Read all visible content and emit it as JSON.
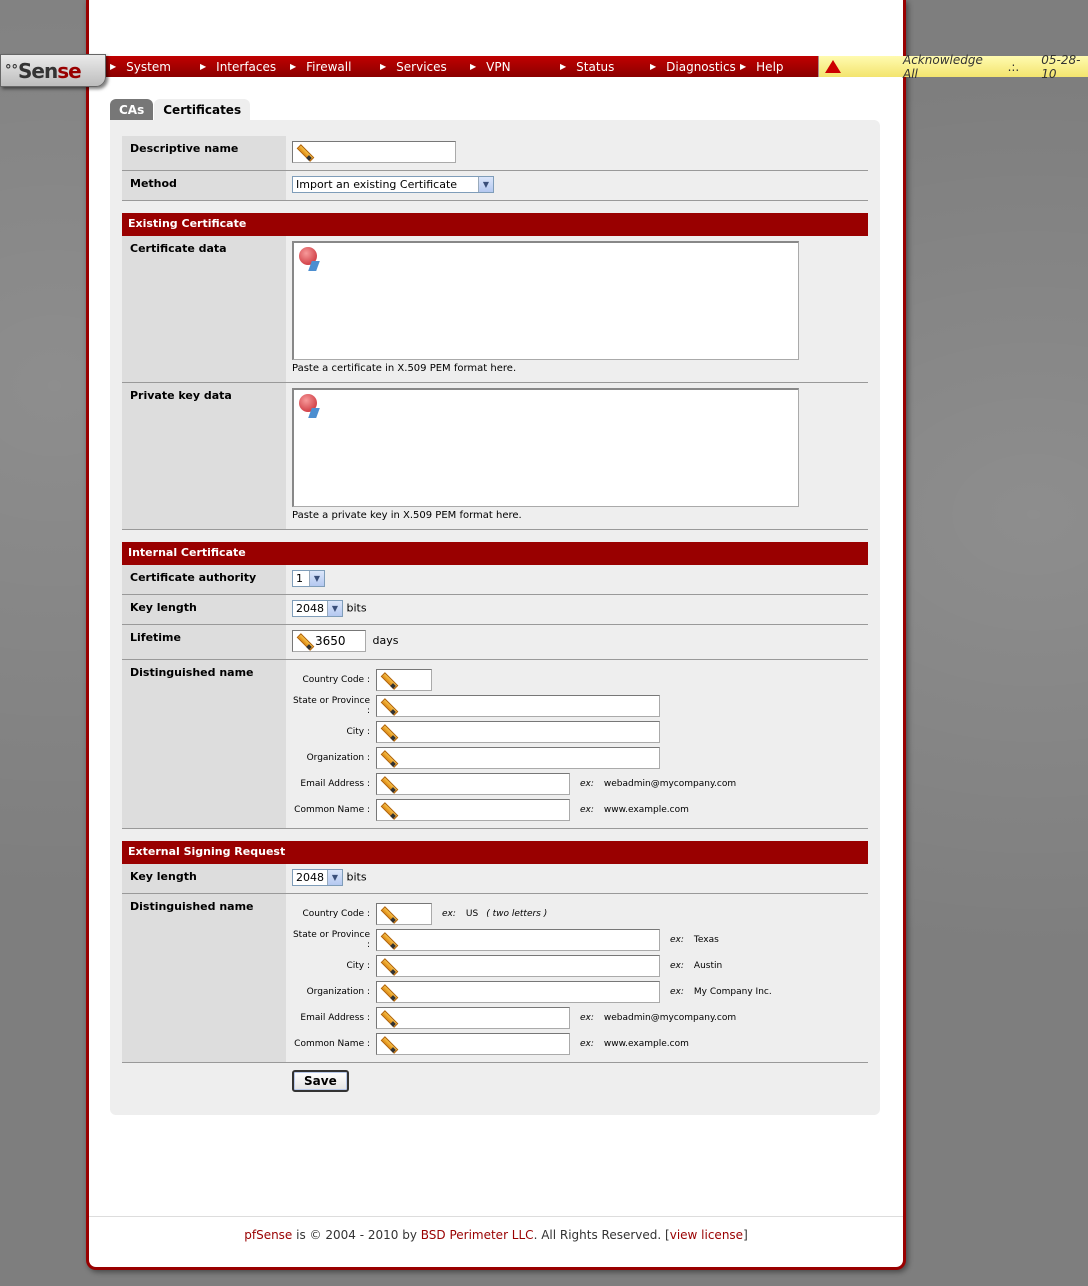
{
  "nav": {
    "logo_mark": "°°",
    "logo_text_a": "Sen",
    "logo_text_b": "se",
    "items": [
      "System",
      "Interfaces",
      "Firewall",
      "Services",
      "VPN",
      "Status",
      "Diagnostics",
      "Help"
    ],
    "ack_label": "Acknowledge All",
    "dots": ".:.",
    "date": "05-28-10"
  },
  "tabs": {
    "cas": "CAs",
    "certificates": "Certificates"
  },
  "form": {
    "descriptive_name_label": "Descriptive name",
    "descriptive_name_value": "",
    "method_label": "Method",
    "method_value": "Import an existing Certificate",
    "existing": {
      "header": "Existing Certificate",
      "cert_label": "Certificate data",
      "cert_help": "Paste a certificate in X.509 PEM format here.",
      "key_label": "Private key data",
      "key_help": "Paste a private key in X.509 PEM format here."
    },
    "internal": {
      "header": "Internal Certificate",
      "ca_label": "Certificate authority",
      "ca_value": "1",
      "keylen_label": "Key length",
      "keylen_value": "2048",
      "bits": "bits",
      "lifetime_label": "Lifetime",
      "lifetime_value": "3650",
      "days": "days",
      "dn_label": "Distinguished name",
      "dn_country": "Country Code :",
      "dn_state": "State or Province :",
      "dn_city": "City :",
      "dn_org": "Organization :",
      "dn_email": "Email Address :",
      "dn_cn": "Common Name :",
      "ex": "ex:",
      "ex_email": "webadmin@mycompany.com",
      "ex_cn": "www.example.com"
    },
    "external": {
      "header": "External Signing Request",
      "keylen_label": "Key length",
      "keylen_value": "2048",
      "bits": "bits",
      "dn_label": "Distinguished name",
      "dn_country": "Country Code :",
      "dn_state": "State or Province :",
      "dn_city": "City :",
      "dn_org": "Organization :",
      "dn_email": "Email Address :",
      "dn_cn": "Common Name :",
      "ex": "ex:",
      "ex_country": "US",
      "ex_country_note": "( two letters )",
      "ex_state": "Texas",
      "ex_city": "Austin",
      "ex_org": "My Company Inc.",
      "ex_email": "webadmin@mycompany.com",
      "ex_cn": "www.example.com"
    },
    "save_label": "Save"
  },
  "footer": {
    "brand": "pfSense",
    "text1": " is © 2004 - 2010 by ",
    "company": "BSD Perimeter LLC",
    "text2": ". All Rights Reserved. [",
    "license": "view license",
    "text3": "]"
  },
  "colors": {
    "accent": "#990000",
    "panel": "#eeeeee",
    "label_bg": "#dddddd"
  }
}
